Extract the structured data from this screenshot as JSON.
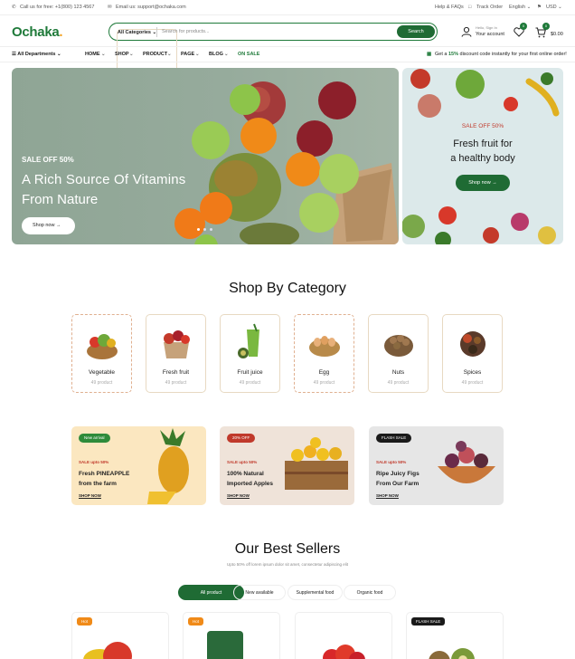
{
  "topbar": {
    "call": "Call us for free: +1(800) 123 4567",
    "email": "Email us: support@ochaka.com",
    "help": "Help & FAQs",
    "track": "Track Order",
    "lang": "English",
    "currency": "USD"
  },
  "header": {
    "logo_main": "Ochaka",
    "logo_dot": ".",
    "search_category": "All Categories",
    "search_placeholder": "Search for products...",
    "search_button": "Search",
    "account_small": "Hello, Sign In",
    "account_big": "Your account",
    "wishlist_count": "0",
    "cart_count": "0",
    "cart_total": "$0.00"
  },
  "nav": {
    "departments": "All Departments",
    "items": [
      "HOME",
      "SHOP",
      "PRODUCT",
      "PAGE",
      "BLOG",
      "ON SALE"
    ],
    "promo_prefix": "Get a ",
    "promo_pct": "15%",
    "promo_suffix": " discount code instantly for your first online order!"
  },
  "hero": {
    "sale": "SALE OFF 50%",
    "title_line1": "A Rich Source Of Vitamins",
    "title_line2": "From Nature",
    "button": "Shop now"
  },
  "side_banner": {
    "sale": "SALE OFF 50%",
    "title_line1": "Fresh fruit for",
    "title_line2": "a healthy body",
    "button": "Shop now"
  },
  "categories_section": {
    "title": "Shop By Category",
    "items": [
      {
        "name": "Vegetable",
        "count": "49 product"
      },
      {
        "name": "Fresh fruit",
        "count": "49 product"
      },
      {
        "name": "Fruit juice",
        "count": "49 product"
      },
      {
        "name": "Egg",
        "count": "49 product"
      },
      {
        "name": "Nuts",
        "count": "49 product"
      },
      {
        "name": "Spices",
        "count": "49 product"
      }
    ]
  },
  "promos": [
    {
      "tag": "New arrival",
      "sale": "SALE upto 50%",
      "line1": "Fresh PINEAPPLE",
      "line2": "from the farm",
      "link": "SHOP NOW",
      "tag_color": "#2e8b3a",
      "bg": "#fbe7c0"
    },
    {
      "tag": "20% OFF",
      "sale": "SALE upto 50%",
      "line1": "100% Natural",
      "line2": "Imported Apples",
      "link": "SHOP NOW",
      "tag_color": "#c0392b",
      "bg": "#efe3d9"
    },
    {
      "tag": "FLASH SALE",
      "sale": "SALE upto 50%",
      "line1": "Ripe Juicy Figs",
      "line2": "From Our Farm",
      "link": "SHOP NOW",
      "tag_color": "#1a1a1a",
      "bg": "#e6e6e6"
    }
  ],
  "best_sellers": {
    "title": "Our Best Sellers",
    "subtitle": "Upto 50% off lorem ipsum dolor sit amet, consectetur adipiscing elit",
    "tabs": [
      "All product",
      "New available",
      "Supplemental food",
      "Organic food"
    ],
    "card_labels": [
      "Hot",
      "Hot",
      "",
      "FLASH SALE"
    ]
  },
  "colors": {
    "brand": "#1f7a3a",
    "accent": "#f0a020",
    "sale": "#c0392b"
  }
}
